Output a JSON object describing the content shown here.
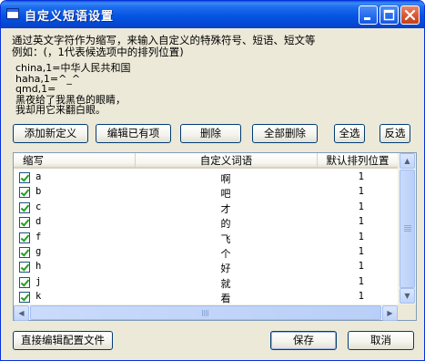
{
  "window": {
    "title": "自定义短语设置",
    "controls": [
      "minimize-icon",
      "maximize-icon",
      "close-icon"
    ]
  },
  "description": {
    "line1": "通过英文字符作为缩写，来输入自定义的特殊符号、短语、短文等",
    "line2": "例如：(，1代表候选项中的排列位置)"
  },
  "examples": [
    "china,1=中华人民共和国",
    "haha,1=^_^",
    "qmd,1=",
    "黑夜给了我黑色的眼睛，",
    "我却用它来翻白眼。"
  ],
  "toolbar": {
    "add": "添加新定义",
    "edit": "编辑已有项",
    "delete": "删除",
    "delete_all": "全部删除",
    "select_all": "全选",
    "invert": "反选"
  },
  "table": {
    "columns": [
      "缩写",
      "自定义词语",
      "默认排列位置"
    ],
    "rows": [
      {
        "key": "a",
        "value": "啊",
        "position": "1",
        "checked": true
      },
      {
        "key": "b",
        "value": "吧",
        "position": "1",
        "checked": true
      },
      {
        "key": "c",
        "value": "才",
        "position": "1",
        "checked": true
      },
      {
        "key": "d",
        "value": "的",
        "position": "1",
        "checked": true
      },
      {
        "key": "f",
        "value": "飞",
        "position": "1",
        "checked": true
      },
      {
        "key": "g",
        "value": "个",
        "position": "1",
        "checked": true
      },
      {
        "key": "h",
        "value": "好",
        "position": "1",
        "checked": true
      },
      {
        "key": "j",
        "value": "就",
        "position": "1",
        "checked": true
      },
      {
        "key": "k",
        "value": "看",
        "position": "1",
        "checked": true
      }
    ]
  },
  "footer": {
    "edit_config": "直接编辑配置文件",
    "save": "保存",
    "cancel": "取消"
  }
}
